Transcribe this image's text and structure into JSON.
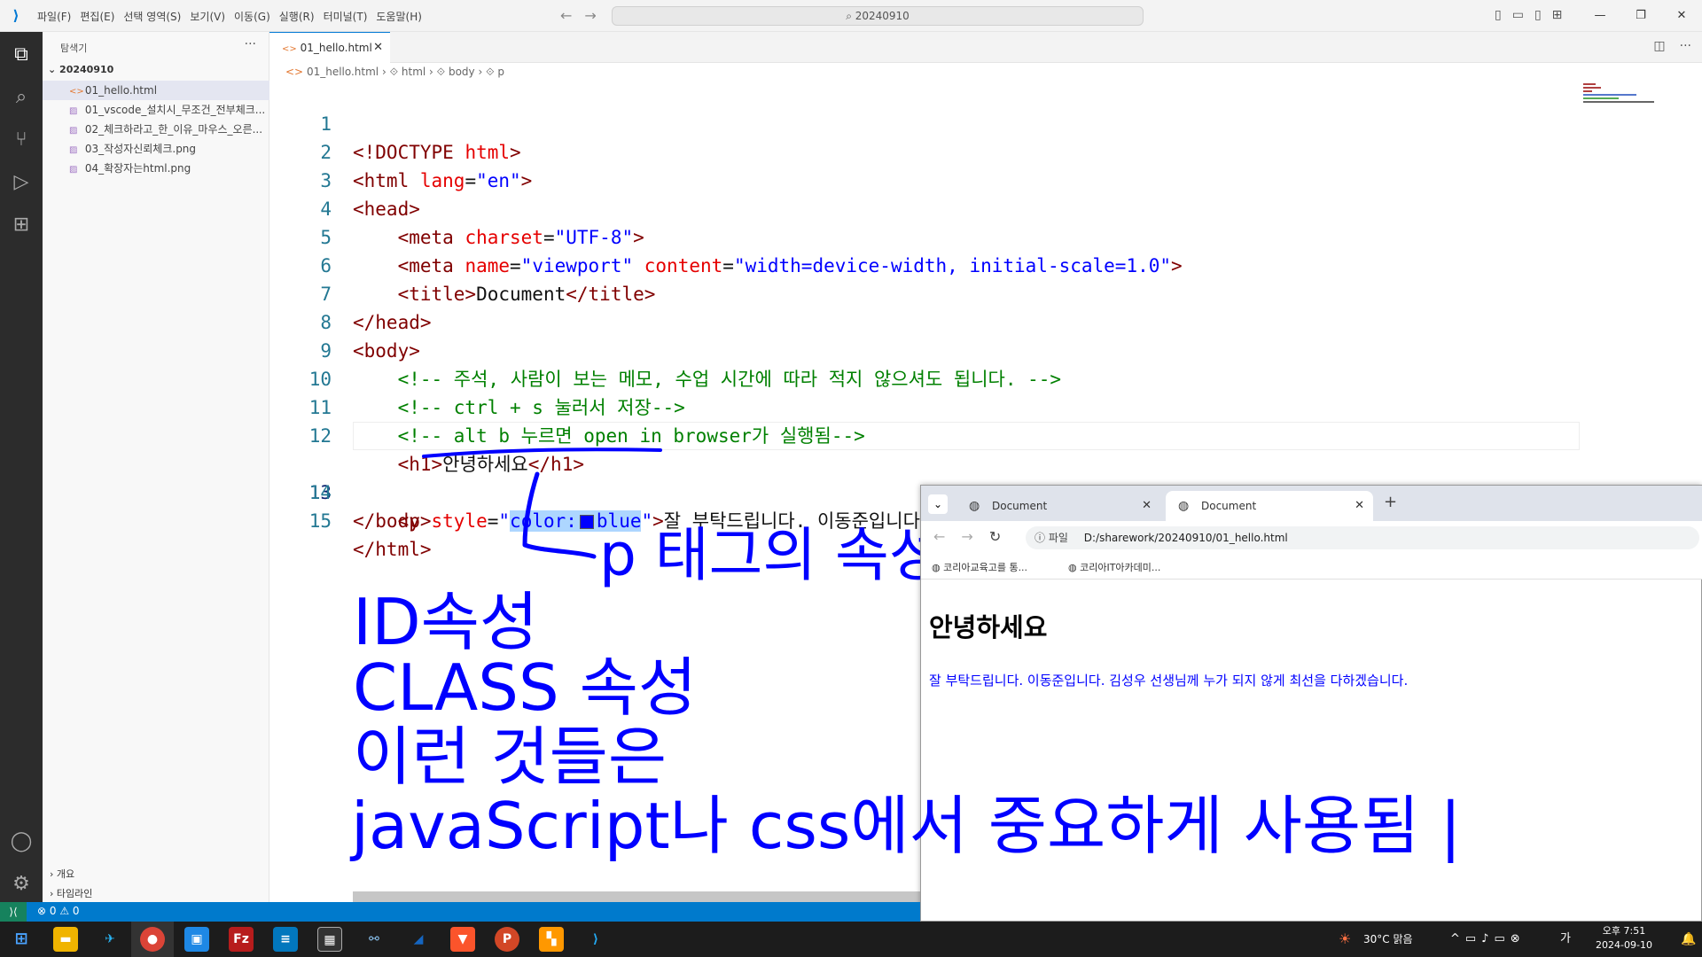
{
  "titlebar": {
    "menu": [
      "파일(F)",
      "편집(E)",
      "선택 영역(S)",
      "보기(V)",
      "이동(G)",
      "실행(R)",
      "터미널(T)",
      "도움말(H)"
    ],
    "search": "20240910"
  },
  "sidebar": {
    "title": "탐색기",
    "folder": "20240910",
    "files": [
      {
        "name": "01_hello.html",
        "type": "html"
      },
      {
        "name": "01_vscode_설치시_무조건_전부체크...",
        "type": "image"
      },
      {
        "name": "02_체크하라고_한_이유_마우스_오른...",
        "type": "image"
      },
      {
        "name": "03_작성자신뢰체크.png",
        "type": "image"
      },
      {
        "name": "04_확장자는html.png",
        "type": "image"
      }
    ],
    "outline": "개요",
    "timeline": "타임라인"
  },
  "editor": {
    "tab": "01_hello.html",
    "breadcrumb": [
      "01_hello.html",
      "html",
      "body",
      "p"
    ],
    "lines": [
      {
        "n": "1",
        "code": "<!DOCTYPE html>"
      },
      {
        "n": "2",
        "code": "<html lang=\"en\">"
      },
      {
        "n": "3",
        "code": "<head>"
      },
      {
        "n": "4",
        "code": "    <meta charset=\"UTF-8\">"
      },
      {
        "n": "5",
        "code": "    <meta name=\"viewport\" content=\"width=device-width, initial-scale=1.0\">"
      },
      {
        "n": "6",
        "code": "    <title>Document</title>"
      },
      {
        "n": "7",
        "code": "</head>"
      },
      {
        "n": "8",
        "code": "<body>"
      },
      {
        "n": "9",
        "code": "    <!-- 주석, 사람이 보는 메모, 수업 시간에 따라 적지 않으셔도 됩니다. -->"
      },
      {
        "n": "10",
        "code": "    <!-- ctrl + s 눌러서 저장-->"
      },
      {
        "n": "11",
        "code": "    <!-- alt b 누르면 open in browser가 실행됨-->"
      },
      {
        "n": "12",
        "code": "    <h1>안녕하세요</h1>"
      },
      {
        "n": "13",
        "code": "    <p style=\"color: blue\">잘 부탁드립니다. 이동준입니다. 김성우 선생님께 누가 되지 않게 최선을 다하겠습니다.</p>"
      },
      {
        "n": "14",
        "code": "</body>"
      },
      {
        "n": "15",
        "code": "</html>"
      }
    ]
  },
  "annotation": {
    "label": "p 태그의 속성",
    "lines": [
      "ID속성",
      "CLASS 속성",
      "이런 것들은",
      "javaScript나 css에서 중요하게 사용됨 |"
    ]
  },
  "browser": {
    "tabs": [
      "Document",
      "Document"
    ],
    "url_label": "파일",
    "url": "D:/sharework/20240910/01_hello.html",
    "bookmarks": [
      "코리아교육고를 통...",
      "코리아IT아카데미..."
    ],
    "h1": "안녕하세요",
    "p": "잘 부탁드립니다. 이동준입니다. 김성우 선생님께 누가 되지 않게 최선을 다하겠습니다."
  },
  "statusbar": {
    "problems": "⊗ 0 ⚠ 0"
  },
  "taskbar": {
    "weather": "30°C  맑음",
    "time": "오후 7:51",
    "date": "2024-09-10"
  }
}
